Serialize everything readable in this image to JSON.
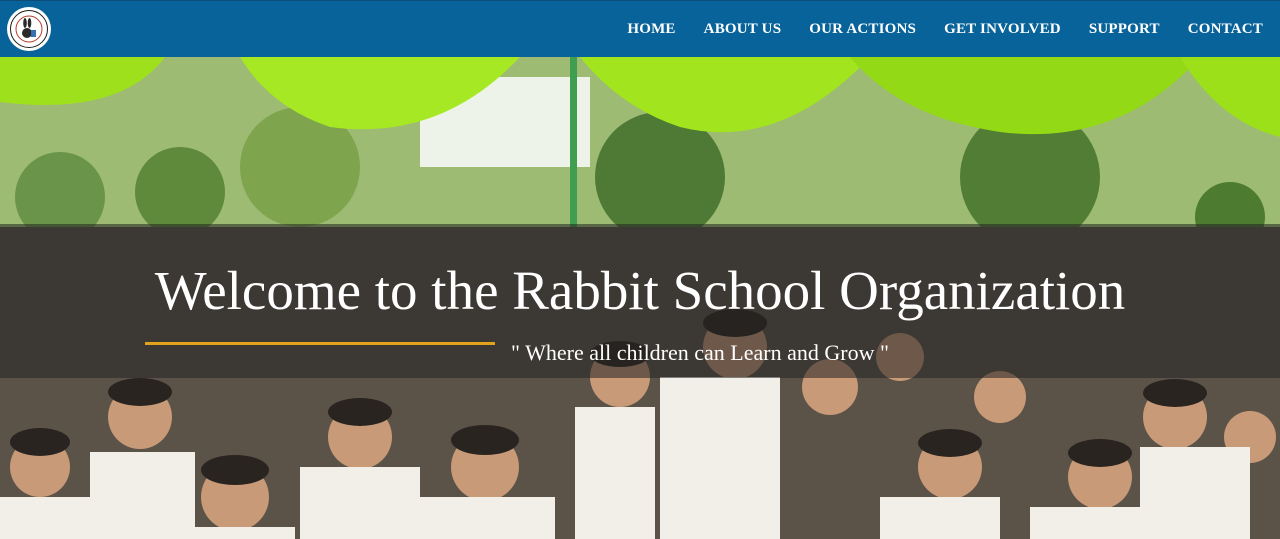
{
  "nav": {
    "logo_icon": "rabbit-school-logo-icon",
    "items": [
      {
        "label": "HOME"
      },
      {
        "label": "ABOUT US"
      },
      {
        "label": "OUR ACTIONS"
      },
      {
        "label": "GET INVOLVED"
      },
      {
        "label": "SUPPORT"
      },
      {
        "label": "CONTACT"
      }
    ]
  },
  "hero": {
    "title": "Welcome to the Rabbit School Organization",
    "tagline": "\" Where all children can Learn and Grow \""
  },
  "colors": {
    "navbar_bg": "#08639a",
    "accent_line": "#e3a21c",
    "text": "#ffffff"
  }
}
